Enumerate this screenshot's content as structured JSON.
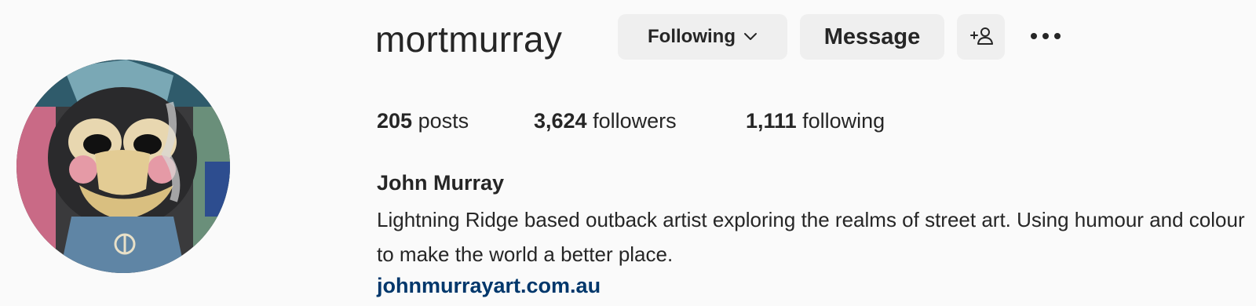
{
  "profile": {
    "username": "mortmurray",
    "full_name": "John Murray",
    "bio": "Lightning Ridge based outback artist exploring the realms of street art. Using humour and colour to make the world a better place.",
    "website": "johnmurrayart.com.au"
  },
  "actions": {
    "following_label": "Following",
    "message_label": "Message",
    "add_user_icon": "add-user-icon",
    "more_icon": "more-options-icon"
  },
  "stats": {
    "posts_count": "205",
    "posts_label": "posts",
    "followers_count": "3,624",
    "followers_label": "followers",
    "following_count": "1,111",
    "following_label": "following"
  },
  "colors": {
    "background": "#fafafa",
    "button_bg": "#efefef",
    "text": "#262626",
    "link": "#00376b"
  }
}
